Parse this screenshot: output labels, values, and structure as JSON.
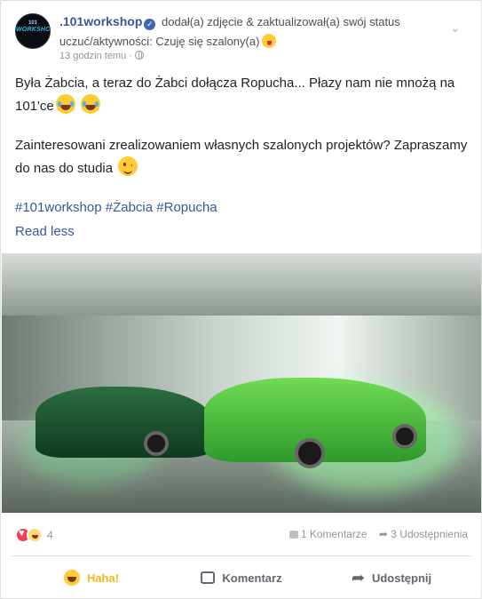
{
  "post": {
    "page_name": ".101workshop",
    "action_text": "dodał(a) zdjęcie & zaktualizował(a) swój status uczuć/aktywności: Czuję się szalony(a)",
    "timestamp": "13 godzin temu ·",
    "avatar_label": "WORKSHOP",
    "avatar_number": "101",
    "paragraph_1": "Była Żabcia, a teraz do Żabci dołącza Ropucha... Płazy nam nie mnożą na 101'ce",
    "paragraph_2": "Zainteresowani zrealizowaniem własnych szalonych projektów? Zapraszamy do nas do studia",
    "hashtags": "#101workshop #Żabcia #Ropucha",
    "read_less": "Read less"
  },
  "reactions": {
    "count": "4",
    "comments": "1 Komentarze",
    "shares": "3 Udostępnienia"
  },
  "actions": {
    "haha": "Haha!",
    "comment": "Komentarz",
    "share": "Udostępnij"
  },
  "icons": [
    "verified-icon",
    "crazy-face-icon",
    "globe-icon",
    "chevron-down-icon",
    "heart-reaction-icon",
    "haha-reaction-icon",
    "comment-icon",
    "share-icon"
  ],
  "colors": {
    "link": "#365899",
    "haha_active": "#f0ba15",
    "love": "#f33e58"
  }
}
